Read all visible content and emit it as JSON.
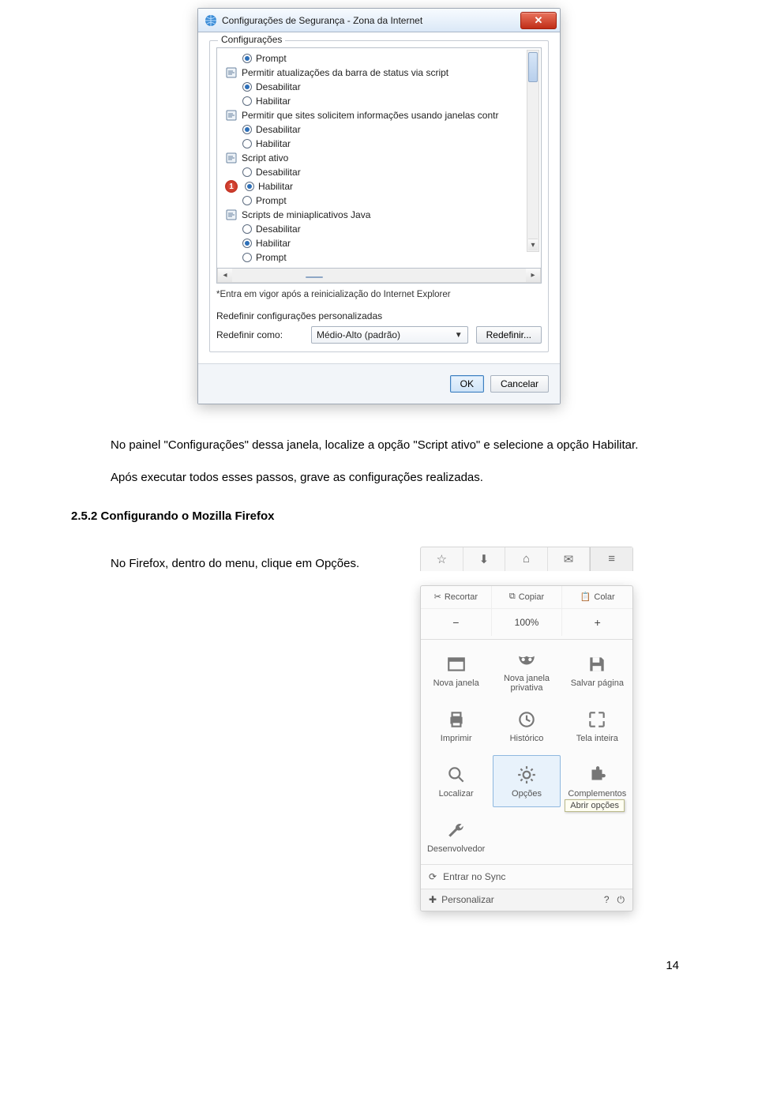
{
  "dialog": {
    "title": "Configurações de Segurança - Zona da Internet",
    "groupLegend": "Configurações",
    "items": [
      {
        "type": "option",
        "selected": true,
        "label": "Prompt"
      },
      {
        "type": "category",
        "label": "Permitir atualizações da barra de status via script"
      },
      {
        "type": "option",
        "selected": true,
        "label": "Desabilitar"
      },
      {
        "type": "option",
        "selected": false,
        "label": "Habilitar"
      },
      {
        "type": "category",
        "label": "Permitir que sites solicitem informações usando janelas contr"
      },
      {
        "type": "option",
        "selected": true,
        "label": "Desabilitar"
      },
      {
        "type": "option",
        "selected": false,
        "label": "Habilitar"
      },
      {
        "type": "category",
        "label": "Script ativo"
      },
      {
        "type": "option",
        "selected": false,
        "label": "Desabilitar"
      },
      {
        "type": "option",
        "selected": true,
        "label": "Habilitar",
        "badge": "1"
      },
      {
        "type": "option",
        "selected": false,
        "label": "Prompt"
      },
      {
        "type": "category",
        "label": "Scripts de miniaplicativos Java"
      },
      {
        "type": "option",
        "selected": false,
        "label": "Desabilitar"
      },
      {
        "type": "option",
        "selected": true,
        "label": "Habilitar"
      },
      {
        "type": "option",
        "selected": false,
        "label": "Prompt"
      }
    ],
    "note": "*Entra em vigor após a reinicialização do Internet Explorer",
    "resetTitle": "Redefinir configurações personalizadas",
    "resetLabel": "Redefinir como:",
    "dropdownValue": "Médio-Alto (padrão)",
    "resetBtn": "Redefinir...",
    "okBtn": "OK",
    "cancelBtn": "Cancelar"
  },
  "text": {
    "p1": "No painel \"Configurações\" dessa janela, localize a opção \"Script ativo\" e selecione a opção Habilitar.",
    "p2": "Após executar todos esses passos, grave as configurações realizadas.",
    "heading": "2.5.2   Configurando o Mozilla Firefox",
    "p3": "No Firefox, dentro do menu, clique em Opções."
  },
  "firefox": {
    "toolbarStrip": {
      "recortar": "Recortar",
      "copiar": "Copiar",
      "colar": "Colar"
    },
    "zoom": "100%",
    "grid": [
      {
        "label": "Nova janela",
        "icon": "window"
      },
      {
        "label": "Nova janela privativa",
        "icon": "mask"
      },
      {
        "label": "Salvar página",
        "icon": "save"
      },
      {
        "label": "Imprimir",
        "icon": "print"
      },
      {
        "label": "Histórico",
        "icon": "history"
      },
      {
        "label": "Tela inteira",
        "icon": "fullscreen"
      },
      {
        "label": "Localizar",
        "icon": "search"
      },
      {
        "label": "Opções",
        "icon": "gear",
        "selected": true
      },
      {
        "label": "Complementos",
        "icon": "puzzle"
      },
      {
        "label": "Desenvolvedor",
        "icon": "wrench"
      }
    ],
    "tooltip": "Abrir opções",
    "syncLabel": "Entrar no Sync",
    "customize": "Personalizar"
  },
  "pageNumber": "14"
}
